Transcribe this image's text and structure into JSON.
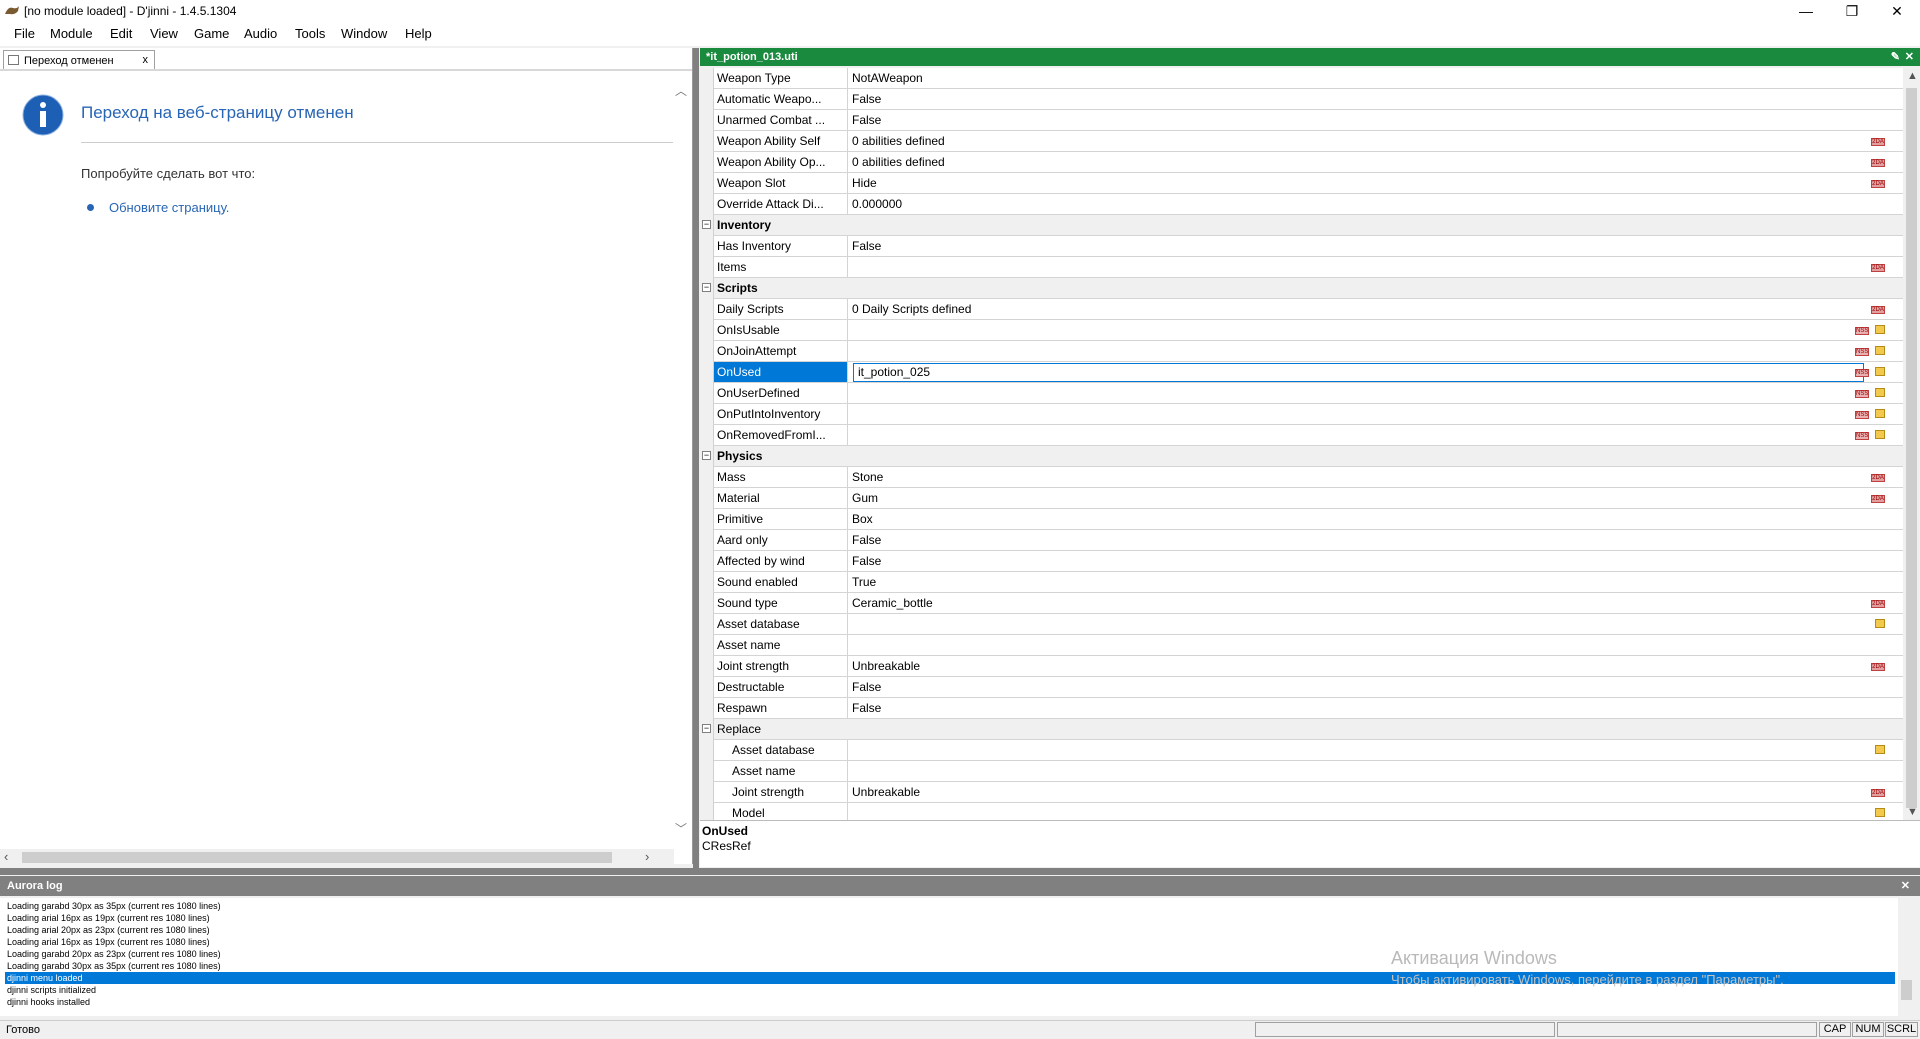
{
  "window": {
    "title": "[no module loaded] - D'jinni - 1.4.5.1304"
  },
  "menu": [
    "File",
    "Module",
    "Edit",
    "View",
    "Game",
    "Audio",
    "Tools",
    "Window",
    "Help"
  ],
  "left_tab": {
    "label": "Переход отменен",
    "close": "x"
  },
  "browser_error": {
    "title": "Переход на веб-страницу отменен",
    "try_text": "Попробуйте сделать вот что:",
    "link": "Обновите страницу."
  },
  "right_panel": {
    "title": "*it_potion_013.uti"
  },
  "properties": [
    {
      "name": "Weapon Type",
      "value": "NotAWeapon",
      "kind": "prop"
    },
    {
      "name": "Automatic Weapo...",
      "value": "False",
      "kind": "prop"
    },
    {
      "name": "Unarmed Combat ...",
      "value": "False",
      "kind": "prop"
    },
    {
      "name": "Weapon Ability Self",
      "value": "0 abilities defined",
      "kind": "prop",
      "icons": [
        "2da"
      ]
    },
    {
      "name": "Weapon Ability Op...",
      "value": "0 abilities defined",
      "kind": "prop",
      "icons": [
        "2da"
      ]
    },
    {
      "name": "Weapon Slot",
      "value": "Hide",
      "kind": "prop",
      "icons": [
        "2da"
      ]
    },
    {
      "name": "Override Attack Di...",
      "value": "0.000000",
      "kind": "prop"
    },
    {
      "name": "Inventory",
      "value": "",
      "kind": "cat"
    },
    {
      "name": "Has Inventory",
      "value": "False",
      "kind": "prop"
    },
    {
      "name": "Items",
      "value": "",
      "kind": "prop",
      "icons": [
        "2da"
      ]
    },
    {
      "name": "Scripts",
      "value": "",
      "kind": "cat"
    },
    {
      "name": "Daily Scripts",
      "value": "0 Daily Scripts defined",
      "kind": "prop",
      "icons": [
        "2da"
      ]
    },
    {
      "name": "OnIsUsable",
      "value": "",
      "kind": "prop",
      "icons": [
        "nss",
        "folder"
      ]
    },
    {
      "name": "OnJoinAttempt",
      "value": "",
      "kind": "prop",
      "icons": [
        "nss",
        "folder"
      ]
    },
    {
      "name": "OnUsed",
      "value": "it_potion_025",
      "kind": "prop",
      "selected": true,
      "icons": [
        "nss",
        "folder"
      ]
    },
    {
      "name": "OnUserDefined",
      "value": "",
      "kind": "prop",
      "icons": [
        "nss",
        "folder"
      ]
    },
    {
      "name": "OnPutIntoInventory",
      "value": "",
      "kind": "prop",
      "icons": [
        "nss",
        "folder"
      ]
    },
    {
      "name": "OnRemovedFromI...",
      "value": "",
      "kind": "prop",
      "icons": [
        "nss",
        "folder"
      ]
    },
    {
      "name": "Physics",
      "value": "",
      "kind": "cat"
    },
    {
      "name": "Mass",
      "value": "Stone",
      "kind": "prop",
      "icons": [
        "2da"
      ]
    },
    {
      "name": "Material",
      "value": "Gum",
      "kind": "prop",
      "icons": [
        "2da"
      ]
    },
    {
      "name": "Primitive",
      "value": "Box",
      "kind": "prop"
    },
    {
      "name": "Aard only",
      "value": "False",
      "kind": "prop"
    },
    {
      "name": "Affected by wind",
      "value": "False",
      "kind": "prop"
    },
    {
      "name": "Sound enabled",
      "value": "True",
      "kind": "prop"
    },
    {
      "name": "Sound type",
      "value": "Ceramic_bottle",
      "kind": "prop",
      "icons": [
        "2da"
      ]
    },
    {
      "name": "Asset database",
      "value": "",
      "kind": "prop",
      "icons": [
        "folder"
      ]
    },
    {
      "name": "Asset name",
      "value": "",
      "kind": "prop"
    },
    {
      "name": "Joint strength",
      "value": "Unbreakable",
      "kind": "prop",
      "icons": [
        "2da"
      ]
    },
    {
      "name": "Destructable",
      "value": "False",
      "kind": "prop"
    },
    {
      "name": "Respawn",
      "value": "False",
      "kind": "prop"
    },
    {
      "name": "Replace",
      "value": "",
      "kind": "sub"
    },
    {
      "name": "Asset database",
      "value": "",
      "kind": "prop",
      "indent": true,
      "icons": [
        "folder"
      ]
    },
    {
      "name": "Asset name",
      "value": "",
      "kind": "prop",
      "indent": true
    },
    {
      "name": "Joint strength",
      "value": "Unbreakable",
      "kind": "prop",
      "indent": true,
      "icons": [
        "2da"
      ]
    },
    {
      "name": "Model",
      "value": "",
      "kind": "prop",
      "indent": true,
      "icons": [
        "folder"
      ]
    }
  ],
  "description": {
    "name": "OnUsed",
    "type": "CResRef"
  },
  "log": {
    "title": "Aurora log",
    "lines": [
      "Loading garabd 30px as 35px (current res 1080 lines)",
      "Loading arial 16px as 19px (current res 1080 lines)",
      "Loading arial 20px as 23px (current res 1080 lines)",
      "Loading arial 16px as 19px (current res 1080 lines)",
      "Loading garabd 20px as 23px (current res 1080 lines)",
      "Loading garabd 30px as 35px (current res 1080 lines)",
      "djinni menu loaded",
      "djinni scripts initialized",
      "djinni hooks installed"
    ],
    "selected_index": 6
  },
  "watermark": {
    "line1": "Активация Windows",
    "line2": "Чтобы активировать Windows, перейдите в раздел \"Параметры\"."
  },
  "status": {
    "text": "Готово",
    "panes": [
      "CAP",
      "NUM",
      "SCRL"
    ]
  },
  "colors": {
    "accent": "#1a8a3e",
    "selection": "#0078d7",
    "link": "#2865b4"
  }
}
